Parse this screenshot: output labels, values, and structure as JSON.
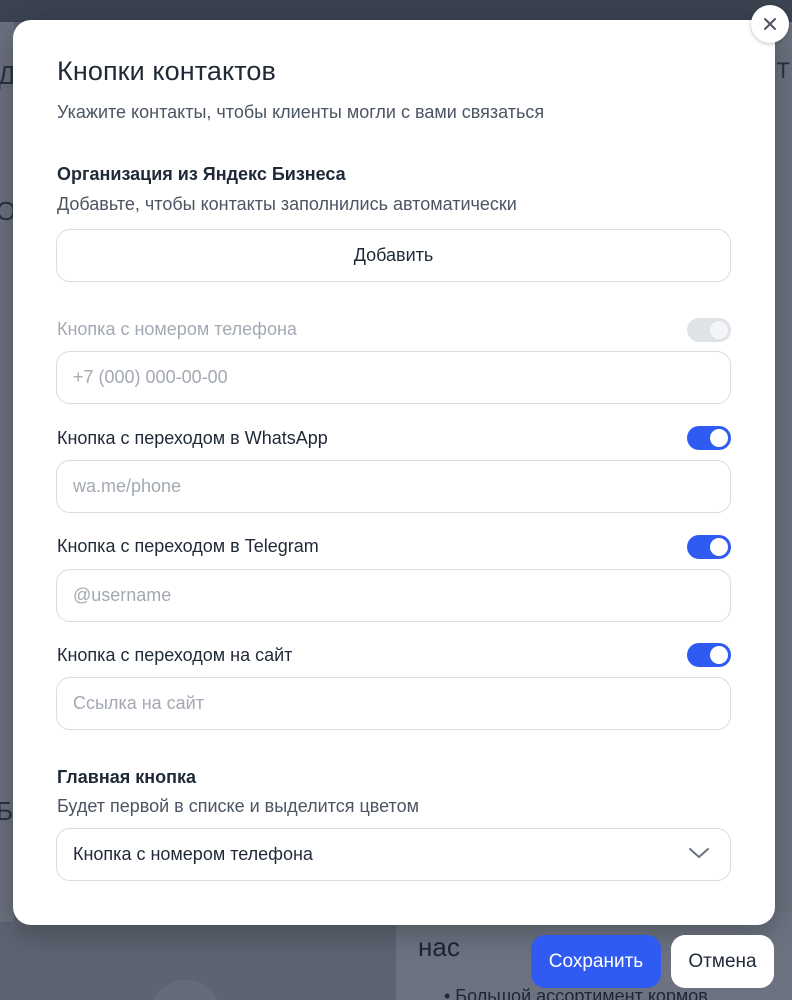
{
  "colors": {
    "accent": "#2f5bf2",
    "overlay": "#5d6371",
    "modal_bg": "#ffffff",
    "muted_text": "#a3a9b3"
  },
  "background": {
    "heading_fragment": "нас",
    "bullet_fragment": "• Большой ассортимент кормов",
    "left_fragments": [
      "Д",
      "О",
      "Б"
    ],
    "right_fragment": "Т"
  },
  "modal": {
    "title": "Кнопки контактов",
    "subtitle": "Укажите контакты, чтобы клиенты могли с вами связаться",
    "close_icon": "close-icon",
    "organization": {
      "title": "Организация из Яндекс Бизнеса",
      "description": "Добавьте, чтобы контакты заполнились автоматически",
      "add_label": "Добавить"
    },
    "fields": [
      {
        "label": "Кнопка с номером телефона",
        "placeholder": "+7 (000) 000-00-00",
        "value": "",
        "enabled": true,
        "disabled": true
      },
      {
        "label": "Кнопка с переходом в WhatsApp",
        "placeholder": "wa.me/phone",
        "value": "",
        "enabled": true,
        "disabled": false
      },
      {
        "label": "Кнопка с переходом в Telegram",
        "placeholder": "@username",
        "value": "",
        "enabled": true,
        "disabled": false
      },
      {
        "label": "Кнопка с переходом на сайт",
        "placeholder": "Ссылка на сайт",
        "value": "",
        "enabled": true,
        "disabled": false
      }
    ],
    "main_button": {
      "title": "Главная кнопка",
      "description": "Будет первой в списке и выделится цветом",
      "selected": "Кнопка с номером телефона",
      "chevron_icon": "chevron-down-icon"
    }
  },
  "footer": {
    "save_label": "Сохранить",
    "cancel_label": "Отмена"
  }
}
